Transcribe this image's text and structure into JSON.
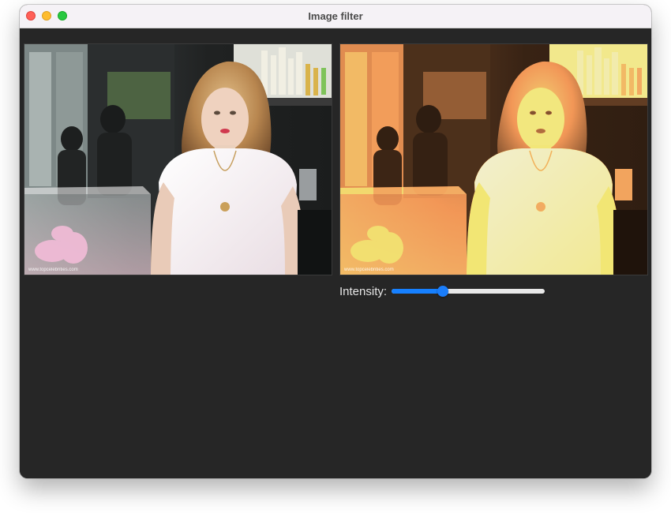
{
  "window": {
    "title": "Image filter"
  },
  "images": {
    "original": {
      "watermark": "www.topcelebrities.com"
    },
    "filtered": {
      "watermark": "www.topcelebrities.com"
    }
  },
  "controls": {
    "intensity_label": "Intensity:",
    "intensity_value": 0.32
  },
  "colors": {
    "window_background": "#262626",
    "accent": "#1680ff"
  }
}
